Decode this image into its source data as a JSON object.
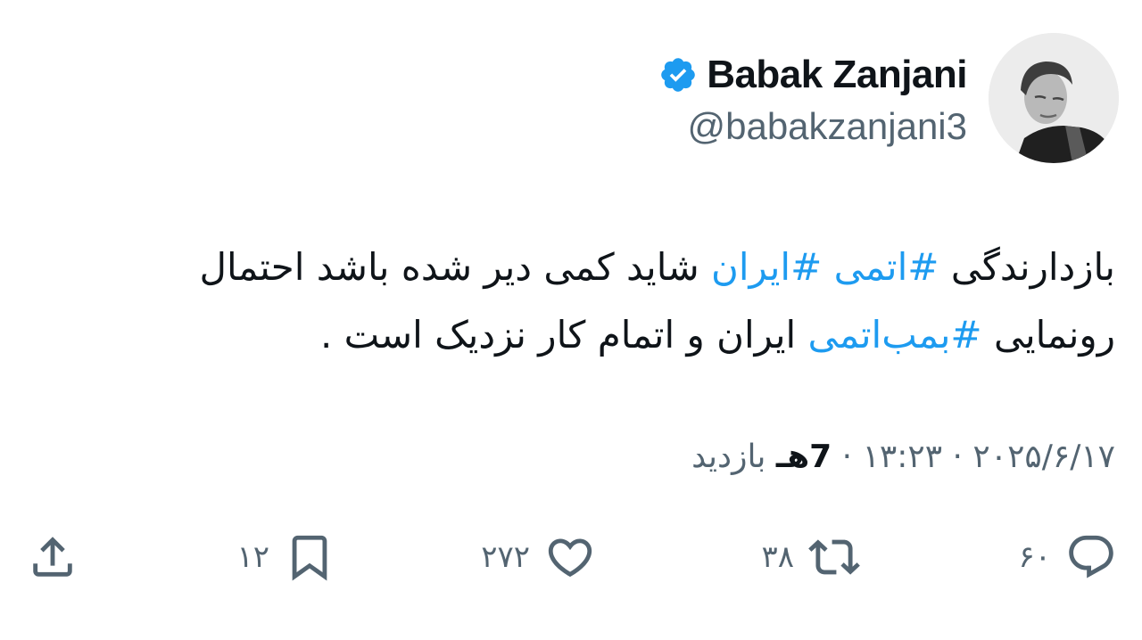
{
  "colors": {
    "hashtag": "#1d9bf0",
    "verified_badge": "#1d9bf0",
    "secondary_text": "#536471",
    "primary_text": "#0f1419"
  },
  "author": {
    "display_name": "Babak Zanjani",
    "handle": "@babakzanjani3",
    "verified_icon": "verified-badge-icon",
    "avatar": "profile-photo"
  },
  "tweet": {
    "line1_part1": "بازدارندگی ",
    "hashtag1": "#اتمی",
    "line1_space1": " ",
    "hashtag2": "#ایران",
    "line1_part2": " شاید کمی دیر شده باشد احتمال",
    "line2_part1": "رونمایی ",
    "hashtag3": "#بمب‌اتمی",
    "line2_part2": " ایران و اتمام کار نزدیک است ."
  },
  "meta": {
    "date": "۲۰۲۵/۶/۱۷",
    "separator": " · ",
    "time": "۱۳:۲۳",
    "views_count": "7هـ",
    "views_label": " بازدید"
  },
  "actions": {
    "replies": {
      "icon": "reply-icon",
      "count": "۶۰"
    },
    "reposts": {
      "icon": "repost-icon",
      "count": "۳۸"
    },
    "likes": {
      "icon": "heart-icon",
      "count": "۲۷۲"
    },
    "bookmarks": {
      "icon": "bookmark-icon",
      "count": "۱۲"
    },
    "share": {
      "icon": "share-icon"
    }
  }
}
